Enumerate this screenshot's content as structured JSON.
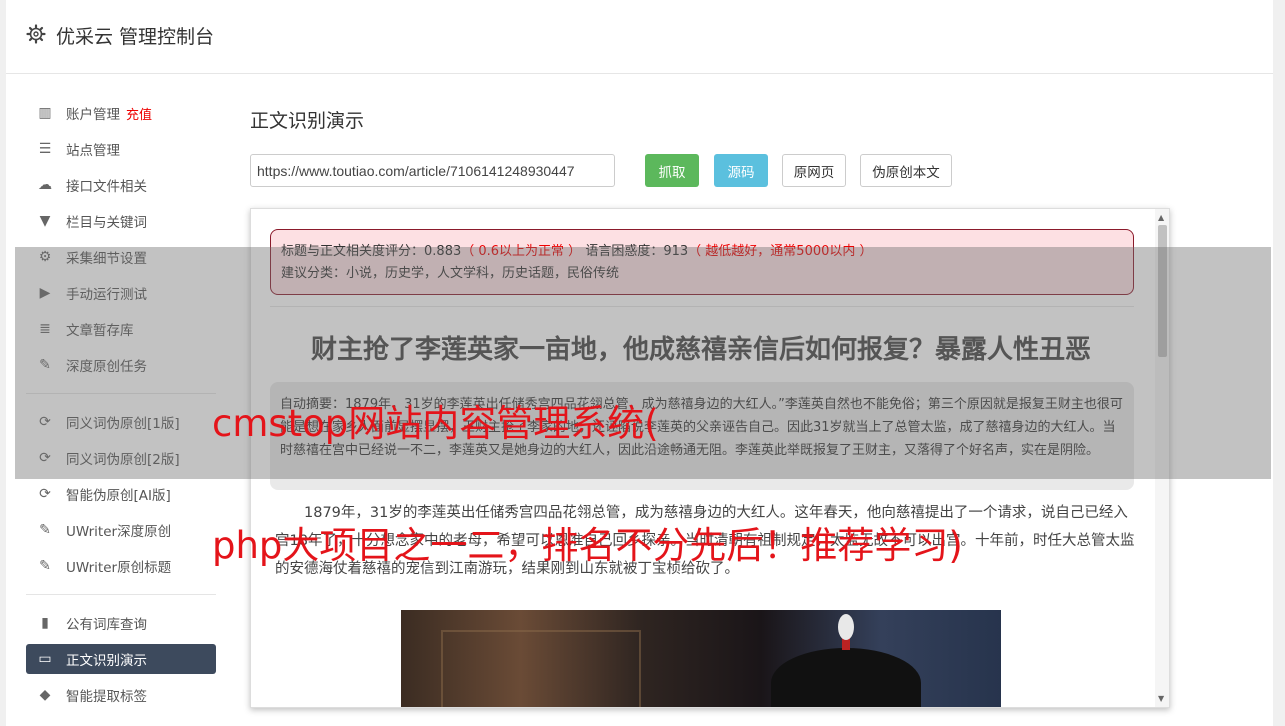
{
  "header": {
    "title": "优采云 管理控制台",
    "icon": "gear-icon"
  },
  "sidebar": {
    "groups": [
      [
        {
          "icon": "bar-chart-icon",
          "glyph": "▥",
          "label": "账户管理",
          "badge": "充值"
        },
        {
          "icon": "server-icon",
          "glyph": "☰",
          "label": "站点管理"
        },
        {
          "icon": "cloud-upload-icon",
          "glyph": "☁",
          "label": "接口文件相关"
        },
        {
          "icon": "filter-icon",
          "glyph": "▼",
          "label": "栏目与关键词"
        },
        {
          "icon": "cogs-icon",
          "glyph": "⚙",
          "label": "采集细节设置"
        },
        {
          "icon": "play-circle-icon",
          "glyph": "▶",
          "label": "手动运行测试"
        },
        {
          "icon": "database-icon",
          "glyph": "≣",
          "label": "文章暂存库"
        },
        {
          "icon": "edit-icon",
          "glyph": "✎",
          "label": "深度原创任务"
        }
      ],
      [
        {
          "icon": "refresh-icon",
          "glyph": "⟳",
          "label": "同义词伪原创[1版]"
        },
        {
          "icon": "refresh-icon",
          "glyph": "⟳",
          "label": "同义词伪原创[2版]"
        },
        {
          "icon": "refresh-icon",
          "glyph": "⟳",
          "label": "智能伪原创[AI版]"
        },
        {
          "icon": "edit-icon",
          "glyph": "✎",
          "label": "UWriter深度原创"
        },
        {
          "icon": "edit-icon",
          "glyph": "✎",
          "label": "UWriter原创标题"
        }
      ],
      [
        {
          "icon": "book-icon",
          "glyph": "▮",
          "label": "公有词库查询"
        },
        {
          "icon": "monitor-icon",
          "glyph": "▭",
          "label": "正文识别演示",
          "active": true
        },
        {
          "icon": "tag-icon",
          "glyph": "◆",
          "label": "智能提取标签"
        }
      ]
    ]
  },
  "main": {
    "title": "正文识别演示",
    "url_value": "https://www.toutiao.com/article/7106141248930447",
    "buttons": {
      "fetch": "抓取",
      "source": "源码",
      "original_page": "原网页",
      "fake_original": "伪原创本文"
    }
  },
  "result": {
    "relevance_label": "标题与正文相关度评分：",
    "relevance_value": "0.883",
    "relevance_hint": "（ 0.6以上为正常 ）",
    "confusion_label": "语言困惑度：",
    "confusion_value": "913",
    "confusion_hint": "（ 越低越好，通常5000以内 ）",
    "category_line": "建议分类：小说，历史学，人文学科，历史话题，民俗传统",
    "article_title": "财主抢了李莲英家一亩地，他成慈禧亲信后如何报复？暴露人性丑恶",
    "summary": "自动摘要：1879年，31岁的李莲英出任储秀宫四品花翎总管，成为慈禧身边的大红人。”李莲英自然也不能免俗；第三个原因就是报复王财主也很可能是想在家乡人面前显摆显摆，王财主抢了李家的地，还诬陷说李莲英的父亲诬告自己。因此31岁就当上了总管太监，成了慈禧身边的大红人。当时慈禧在宫中已经说一不二，李莲英又是她身边的大红人，因此沿途畅通无阻。李莲英此举既报复了王财主，又落得了个好名声，实在是阴险。",
    "paragraph": "1879年，31岁的李莲英出任储秀宫四品花翎总管，成为慈禧身边的大红人。这年春天，他向慈禧提出了一个请求，说自己已经入宫18年了，十分想念家中的老母，希望可以恩准自己回乡探亲。当时清朝有祖制规定，太监无故不可以出宫。十年前，时任大总管太监的安德海仗着慈禧的宠信到江南游玩，结果刚到山东就被丁宝桢给砍了。"
  },
  "watermark": {
    "line1": "cmstop网站内容管理系统(",
    "line2": "php大项目之一二，排名不分先后！推荐学习)"
  }
}
